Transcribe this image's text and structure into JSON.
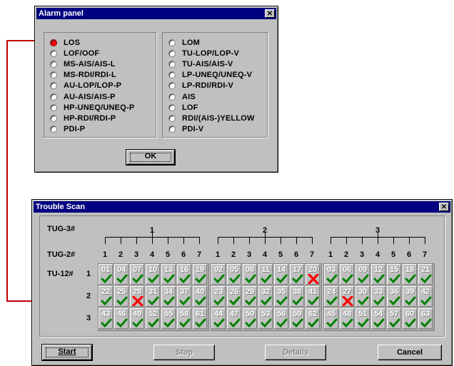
{
  "alarm_panel": {
    "title": "Alarm panel",
    "close_glyph": "✕",
    "left_items": [
      {
        "label": "LOS",
        "active": true
      },
      {
        "label": "LOF/OOF",
        "active": false
      },
      {
        "label": "MS-AIS/AIS-L",
        "active": false
      },
      {
        "label": "MS-RDI/RDI-L",
        "active": false
      },
      {
        "label": "AU-LOP/LOP-P",
        "active": false
      },
      {
        "label": "AU-AIS/AIS-P",
        "active": false
      },
      {
        "label": "HP-UNEQ/UNEQ-P",
        "active": false
      },
      {
        "label": "HP-RDI/RDI-P",
        "active": false
      },
      {
        "label": "PDI-P",
        "active": false
      }
    ],
    "right_items": [
      {
        "label": "LOM",
        "active": false
      },
      {
        "label": "TU-LOP/LOP-V",
        "active": false
      },
      {
        "label": "TU-AIS/AIS-V",
        "active": false
      },
      {
        "label": "LP-UNEQ/UNEQ-V",
        "active": false
      },
      {
        "label": "LP-RDI/RDI-V",
        "active": false
      },
      {
        "label": "AIS",
        "active": false
      },
      {
        "label": "LOF",
        "active": false
      },
      {
        "label": "RDI/(AIS-)YELLOW",
        "active": false
      },
      {
        "label": "PDI-V",
        "active": false
      }
    ],
    "ok_label": "OK",
    "active_color": "#ff0000"
  },
  "trouble_scan": {
    "title": "Trouble Scan",
    "close_glyph": "✕",
    "tug3_label": "TUG-3#",
    "tug2_label": "TUG-2#",
    "tu12_label": "TU-12#",
    "tug3_numbers": [
      "1",
      "2",
      "3"
    ],
    "tug2_numbers": [
      "1",
      "2",
      "3",
      "4",
      "5",
      "6",
      "7"
    ],
    "row_labels": [
      "1",
      "2",
      "3"
    ],
    "groups": [
      {
        "rows": [
          [
            "01",
            "04",
            "07",
            "10",
            "13",
            "16",
            "19"
          ],
          [
            "22",
            "25",
            "28",
            "31",
            "34",
            "37",
            "40"
          ],
          [
            "43",
            "46",
            "49",
            "52",
            "55",
            "58",
            "61"
          ]
        ]
      },
      {
        "rows": [
          [
            "02",
            "05",
            "08",
            "11",
            "14",
            "17",
            "20"
          ],
          [
            "23",
            "26",
            "29",
            "32",
            "35",
            "38",
            "41"
          ],
          [
            "44",
            "47",
            "50",
            "53",
            "56",
            "59",
            "62"
          ]
        ]
      },
      {
        "rows": [
          [
            "03",
            "06",
            "09",
            "12",
            "15",
            "18",
            "21"
          ],
          [
            "24",
            "27",
            "30",
            "33",
            "36",
            "39",
            "42"
          ],
          [
            "45",
            "48",
            "51",
            "54",
            "57",
            "60",
            "63"
          ]
        ]
      }
    ],
    "failed_channels": [
      "20",
      "28",
      "27"
    ],
    "ok_mark_color": "#008000",
    "fail_mark_color": "#ff0000",
    "buttons": {
      "start": "Start",
      "stop": "Stop",
      "details": "Details",
      "cancel": "Cancel"
    }
  },
  "connector_color": "#c00000"
}
